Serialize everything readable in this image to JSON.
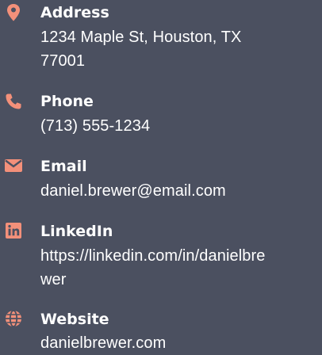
{
  "colors": {
    "background": "#4b5060",
    "accent": "#f3907a",
    "text": "#ffffff"
  },
  "contacts": [
    {
      "icon": "map-pin-icon",
      "label": "Address",
      "value_line1": "1234 Maple St, Houston, TX",
      "value_line2": "77001"
    },
    {
      "icon": "phone-icon",
      "label": "Phone",
      "value": "(713) 555-1234"
    },
    {
      "icon": "envelope-icon",
      "label": "Email",
      "value": "daniel.brewer@email.com"
    },
    {
      "icon": "linkedin-icon",
      "label": "LinkedIn",
      "value_line1": "https://linkedin.com/in/danielbre",
      "value_line2": "wer"
    },
    {
      "icon": "globe-icon",
      "label": "Website",
      "value": "danielbrewer.com"
    }
  ]
}
